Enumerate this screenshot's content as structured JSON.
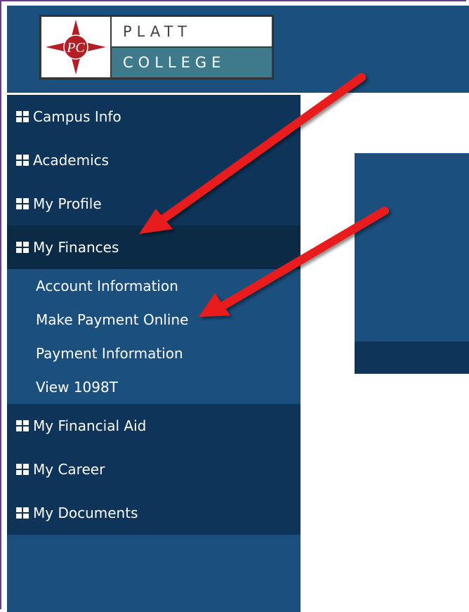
{
  "logo": {
    "monogram": "PC",
    "top_text": "PLATT",
    "bottom_text": "COLLEGE"
  },
  "sidebar": {
    "items": [
      {
        "label": "Campus Info",
        "icon": "grid-icon"
      },
      {
        "label": "Academics",
        "icon": "grid-icon"
      },
      {
        "label": "My Profile",
        "icon": "grid-icon"
      },
      {
        "label": "My Finances",
        "icon": "grid-icon",
        "active": true
      },
      {
        "label": "My Financial Aid",
        "icon": "grid-icon"
      },
      {
        "label": "My Career",
        "icon": "grid-icon"
      },
      {
        "label": "My Documents",
        "icon": "grid-icon"
      }
    ],
    "finances_subitems": [
      {
        "label": "Account Information"
      },
      {
        "label": "Make Payment Online"
      },
      {
        "label": "Payment Information"
      },
      {
        "label": "View 1098T"
      }
    ]
  },
  "colors": {
    "header": "#1b4f7e",
    "nav": "#0e3459",
    "nav_active": "#0b2a45",
    "logo_red": "#b22025",
    "logo_teal": "#3e7a8c",
    "arrow": "#e81c1c"
  }
}
